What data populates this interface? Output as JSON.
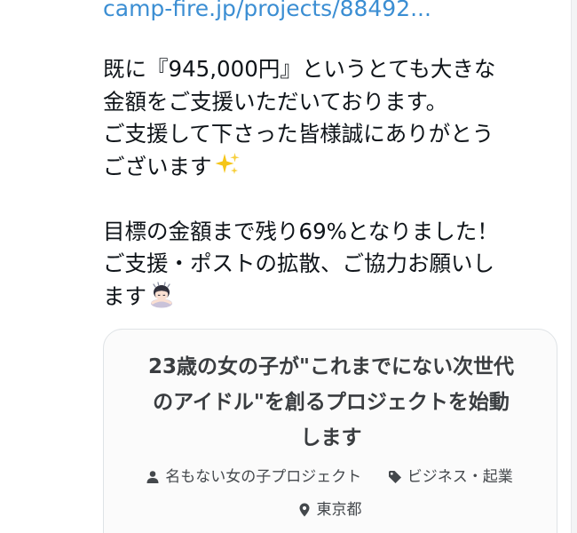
{
  "tweet": {
    "link_text": "camp-fire.jp/projects/88492...",
    "lines": [
      "既に『945,000円』というとても大きな",
      "金額をご支援いただいております。",
      "ご支援して下さった皆様誠にありがとう",
      "ございます",
      "",
      "目標の金額まで残り69%となりました！",
      "ご支援・ポストの拡散、ご協力お願いし",
      "ます"
    ],
    "emoji": {
      "line4": "sparkles-icon",
      "line8": "person-bowing-icon"
    }
  },
  "card": {
    "title_lines": [
      "23歳の女の子が\"これまでにない次世代",
      "のアイドル\"を創るプロジェクトを始動",
      "します"
    ],
    "owner": "名もない女の子プロジェクト",
    "category": "ビジネス・起業",
    "location": "東京都",
    "icons": {
      "owner": "user-icon",
      "category": "tag-icon",
      "location": "location-pin-icon"
    }
  },
  "colors": {
    "link": "#3b8ed3",
    "text": "#0f1419",
    "card_border": "#dfe3e6",
    "card_title": "#3a3d40"
  }
}
